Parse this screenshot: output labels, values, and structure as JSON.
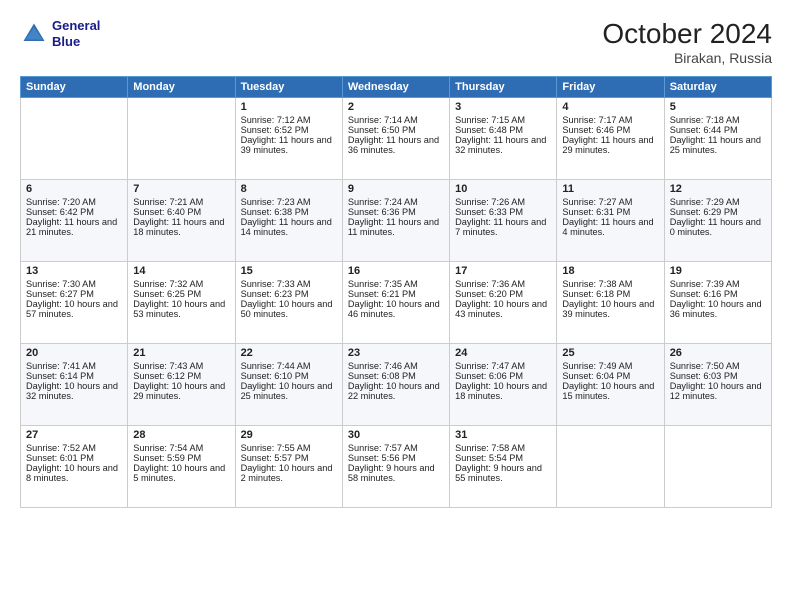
{
  "header": {
    "logo_line1": "General",
    "logo_line2": "Blue",
    "title": "October 2024",
    "location": "Birakan, Russia"
  },
  "columns": [
    "Sunday",
    "Monday",
    "Tuesday",
    "Wednesday",
    "Thursday",
    "Friday",
    "Saturday"
  ],
  "weeks": [
    [
      {
        "day": "",
        "info": ""
      },
      {
        "day": "",
        "info": ""
      },
      {
        "day": "1",
        "info": "Sunrise: 7:12 AM\nSunset: 6:52 PM\nDaylight: 11 hours and 39 minutes."
      },
      {
        "day": "2",
        "info": "Sunrise: 7:14 AM\nSunset: 6:50 PM\nDaylight: 11 hours and 36 minutes."
      },
      {
        "day": "3",
        "info": "Sunrise: 7:15 AM\nSunset: 6:48 PM\nDaylight: 11 hours and 32 minutes."
      },
      {
        "day": "4",
        "info": "Sunrise: 7:17 AM\nSunset: 6:46 PM\nDaylight: 11 hours and 29 minutes."
      },
      {
        "day": "5",
        "info": "Sunrise: 7:18 AM\nSunset: 6:44 PM\nDaylight: 11 hours and 25 minutes."
      }
    ],
    [
      {
        "day": "6",
        "info": "Sunrise: 7:20 AM\nSunset: 6:42 PM\nDaylight: 11 hours and 21 minutes."
      },
      {
        "day": "7",
        "info": "Sunrise: 7:21 AM\nSunset: 6:40 PM\nDaylight: 11 hours and 18 minutes."
      },
      {
        "day": "8",
        "info": "Sunrise: 7:23 AM\nSunset: 6:38 PM\nDaylight: 11 hours and 14 minutes."
      },
      {
        "day": "9",
        "info": "Sunrise: 7:24 AM\nSunset: 6:36 PM\nDaylight: 11 hours and 11 minutes."
      },
      {
        "day": "10",
        "info": "Sunrise: 7:26 AM\nSunset: 6:33 PM\nDaylight: 11 hours and 7 minutes."
      },
      {
        "day": "11",
        "info": "Sunrise: 7:27 AM\nSunset: 6:31 PM\nDaylight: 11 hours and 4 minutes."
      },
      {
        "day": "12",
        "info": "Sunrise: 7:29 AM\nSunset: 6:29 PM\nDaylight: 11 hours and 0 minutes."
      }
    ],
    [
      {
        "day": "13",
        "info": "Sunrise: 7:30 AM\nSunset: 6:27 PM\nDaylight: 10 hours and 57 minutes."
      },
      {
        "day": "14",
        "info": "Sunrise: 7:32 AM\nSunset: 6:25 PM\nDaylight: 10 hours and 53 minutes."
      },
      {
        "day": "15",
        "info": "Sunrise: 7:33 AM\nSunset: 6:23 PM\nDaylight: 10 hours and 50 minutes."
      },
      {
        "day": "16",
        "info": "Sunrise: 7:35 AM\nSunset: 6:21 PM\nDaylight: 10 hours and 46 minutes."
      },
      {
        "day": "17",
        "info": "Sunrise: 7:36 AM\nSunset: 6:20 PM\nDaylight: 10 hours and 43 minutes."
      },
      {
        "day": "18",
        "info": "Sunrise: 7:38 AM\nSunset: 6:18 PM\nDaylight: 10 hours and 39 minutes."
      },
      {
        "day": "19",
        "info": "Sunrise: 7:39 AM\nSunset: 6:16 PM\nDaylight: 10 hours and 36 minutes."
      }
    ],
    [
      {
        "day": "20",
        "info": "Sunrise: 7:41 AM\nSunset: 6:14 PM\nDaylight: 10 hours and 32 minutes."
      },
      {
        "day": "21",
        "info": "Sunrise: 7:43 AM\nSunset: 6:12 PM\nDaylight: 10 hours and 29 minutes."
      },
      {
        "day": "22",
        "info": "Sunrise: 7:44 AM\nSunset: 6:10 PM\nDaylight: 10 hours and 25 minutes."
      },
      {
        "day": "23",
        "info": "Sunrise: 7:46 AM\nSunset: 6:08 PM\nDaylight: 10 hours and 22 minutes."
      },
      {
        "day": "24",
        "info": "Sunrise: 7:47 AM\nSunset: 6:06 PM\nDaylight: 10 hours and 18 minutes."
      },
      {
        "day": "25",
        "info": "Sunrise: 7:49 AM\nSunset: 6:04 PM\nDaylight: 10 hours and 15 minutes."
      },
      {
        "day": "26",
        "info": "Sunrise: 7:50 AM\nSunset: 6:03 PM\nDaylight: 10 hours and 12 minutes."
      }
    ],
    [
      {
        "day": "27",
        "info": "Sunrise: 7:52 AM\nSunset: 6:01 PM\nDaylight: 10 hours and 8 minutes."
      },
      {
        "day": "28",
        "info": "Sunrise: 7:54 AM\nSunset: 5:59 PM\nDaylight: 10 hours and 5 minutes."
      },
      {
        "day": "29",
        "info": "Sunrise: 7:55 AM\nSunset: 5:57 PM\nDaylight: 10 hours and 2 minutes."
      },
      {
        "day": "30",
        "info": "Sunrise: 7:57 AM\nSunset: 5:56 PM\nDaylight: 9 hours and 58 minutes."
      },
      {
        "day": "31",
        "info": "Sunrise: 7:58 AM\nSunset: 5:54 PM\nDaylight: 9 hours and 55 minutes."
      },
      {
        "day": "",
        "info": ""
      },
      {
        "day": "",
        "info": ""
      }
    ]
  ]
}
